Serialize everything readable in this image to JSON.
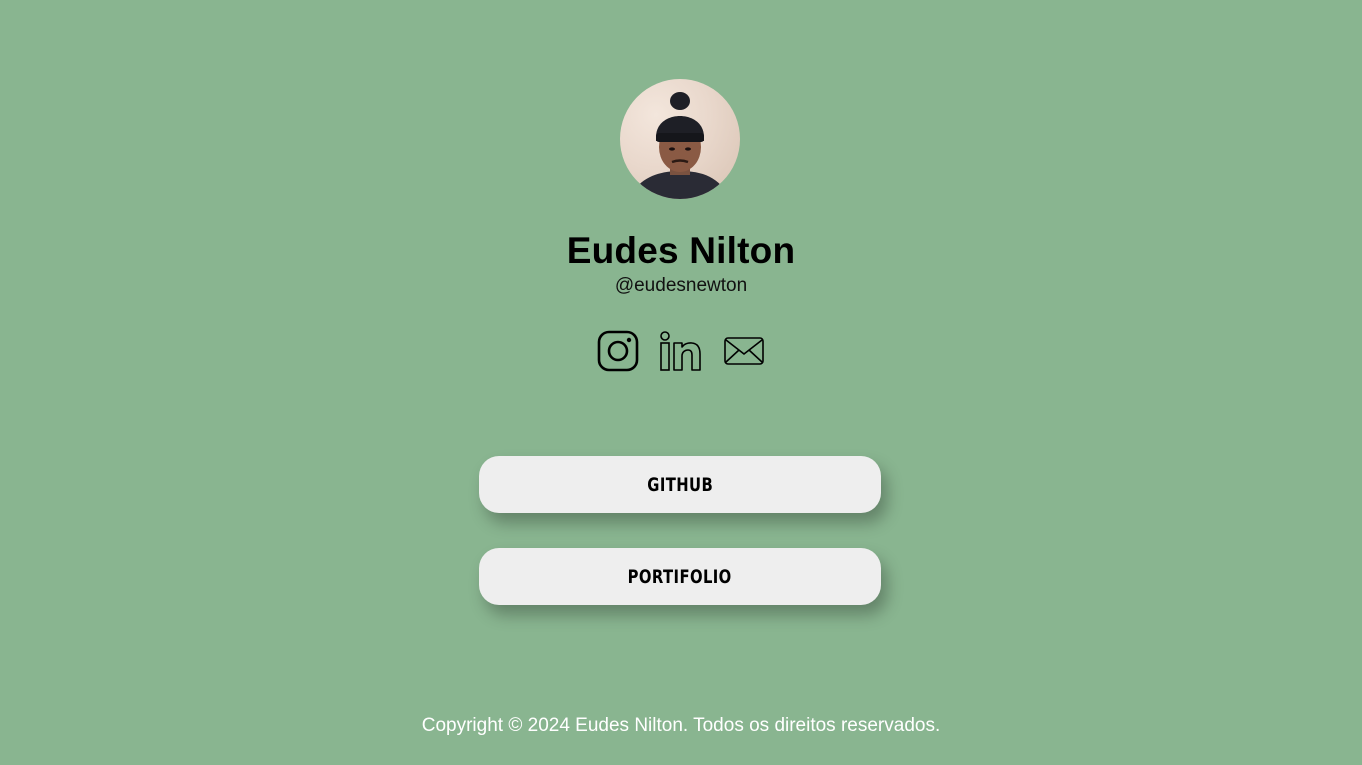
{
  "profile": {
    "name": "Eudes Nilton",
    "handle": "@eudesnewton"
  },
  "socials": [
    {
      "icon": "instagram-icon"
    },
    {
      "icon": "linkedin-icon"
    },
    {
      "icon": "mail-icon"
    }
  ],
  "links": [
    {
      "label": "GITHUB"
    },
    {
      "label": "PORTIFOLIO"
    }
  ],
  "footer": {
    "text": "Copyright © 2024 Eudes Nilton. Todos os direitos reservados."
  },
  "colors": {
    "background": "#89b590",
    "button": "#eeeeee",
    "footer_text": "#ffffff"
  }
}
